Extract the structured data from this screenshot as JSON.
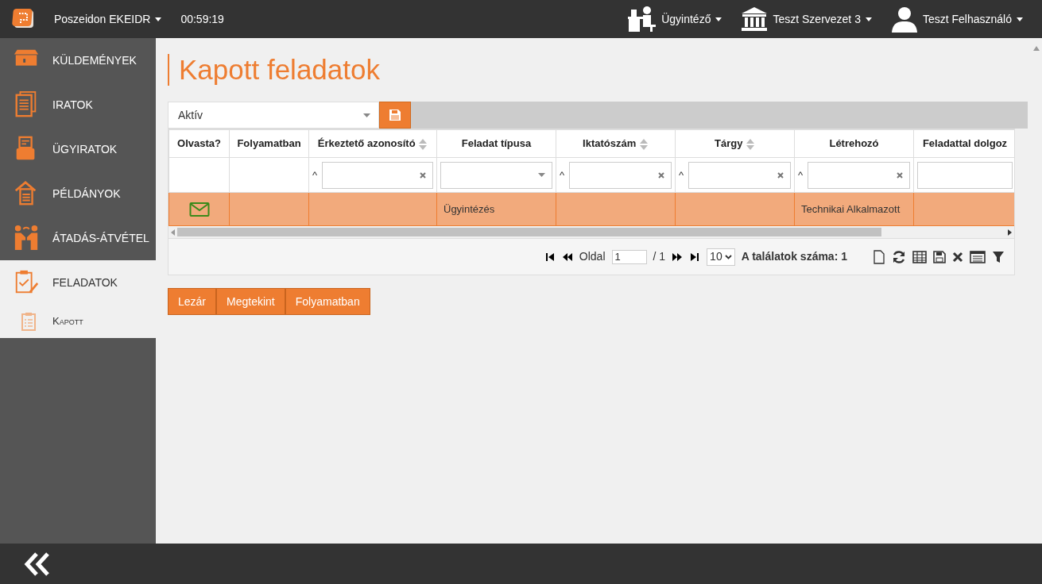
{
  "topbar": {
    "app_menu": "Poszeidon EKEIDR",
    "timer": "00:59:19",
    "menus": [
      {
        "label": "Ügyintéző"
      },
      {
        "label": "Teszt Szervezet 3"
      },
      {
        "label": "Teszt Felhasználó"
      }
    ]
  },
  "sidebar": {
    "items": [
      {
        "label": "KÜLDEMÉNYEK",
        "selected": false
      },
      {
        "label": "IRATOK",
        "selected": false
      },
      {
        "label": "ÜGYIRATOK",
        "selected": false
      },
      {
        "label": "PÉLDÁNYOK",
        "selected": false
      },
      {
        "label": "ÁTADÁS-ÁTVÉTEL",
        "selected": false
      },
      {
        "label": "FELADATOK",
        "selected": true,
        "children": [
          {
            "label": "Kapott",
            "selected": true
          }
        ]
      }
    ]
  },
  "page_title": "Kapott feladatok",
  "filter_select": {
    "value": "Aktív"
  },
  "table": {
    "columns": [
      {
        "label": "Olvasta?",
        "sortable": false,
        "kind": "none"
      },
      {
        "label": "Folyamatban",
        "sortable": false,
        "kind": "none"
      },
      {
        "label": "Érkeztető azonosító",
        "sortable": true,
        "kind": "text",
        "prefix": "^"
      },
      {
        "label": "Feladat típusa",
        "sortable": false,
        "kind": "select"
      },
      {
        "label": "Iktatószám",
        "sortable": true,
        "kind": "text",
        "prefix": "^"
      },
      {
        "label": "Tárgy",
        "sortable": true,
        "kind": "text",
        "prefix": "^"
      },
      {
        "label": "Létrehozó",
        "sortable": false,
        "kind": "text",
        "prefix": "^"
      },
      {
        "label": "Feladattal dolgoz",
        "sortable": false,
        "kind": "plain"
      }
    ],
    "rows": [
      {
        "selected": true,
        "read": false,
        "cells": [
          "",
          "",
          "",
          "Ügyintézés",
          "",
          "",
          "Technikai Alkalmazott",
          ""
        ]
      }
    ]
  },
  "pager": {
    "page_label": "Oldal",
    "page": "1",
    "total": "/ 1",
    "page_size": "10",
    "result": "A találatok száma: 1"
  },
  "buttons": [
    "Lezár",
    "Megtekint",
    "Folyamatban"
  ]
}
